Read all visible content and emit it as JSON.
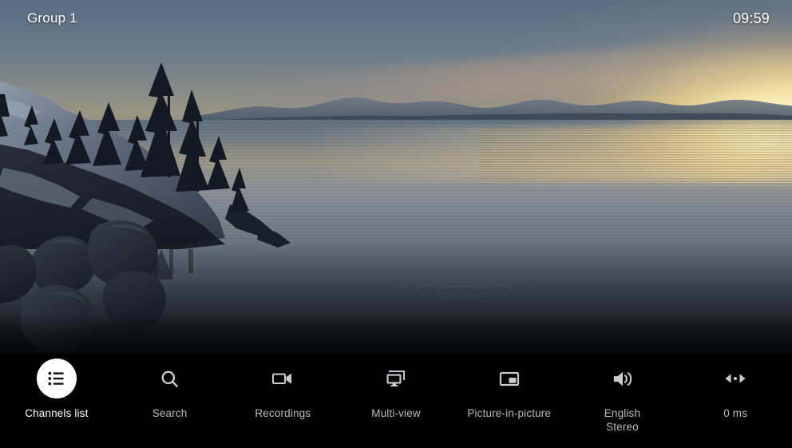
{
  "header": {
    "group_label": "Group 1",
    "clock": "09:59"
  },
  "theme": {
    "selected_icon_bg": "#ffffff",
    "selected_label_color": "#ffffff",
    "label_color": "#b9bcbe",
    "bar_background": "#000000"
  },
  "menu": {
    "items": [
      {
        "id": "channels-list",
        "label": "Channels list",
        "icon": "list-icon",
        "selected": true
      },
      {
        "id": "search",
        "label": "Search",
        "icon": "search-icon",
        "selected": false
      },
      {
        "id": "recordings",
        "label": "Recordings",
        "icon": "video-camera-icon",
        "selected": false
      },
      {
        "id": "multi-view",
        "label": "Multi-view",
        "icon": "multi-screen-icon",
        "selected": false
      },
      {
        "id": "picture-in-picture",
        "label": "Picture-in-picture",
        "icon": "picture-in-picture-icon",
        "selected": false
      },
      {
        "id": "audio-track",
        "label": "English",
        "label2": "Stereo",
        "icon": "volume-up-icon",
        "selected": false
      },
      {
        "id": "audio-sync",
        "label": "0 ms",
        "icon": "audio-sync-icon",
        "selected": false
      }
    ]
  },
  "video": {
    "scene_description": "Lake sunset with pine-tree headland, snowy shore, boulders and mirror-calm water"
  }
}
